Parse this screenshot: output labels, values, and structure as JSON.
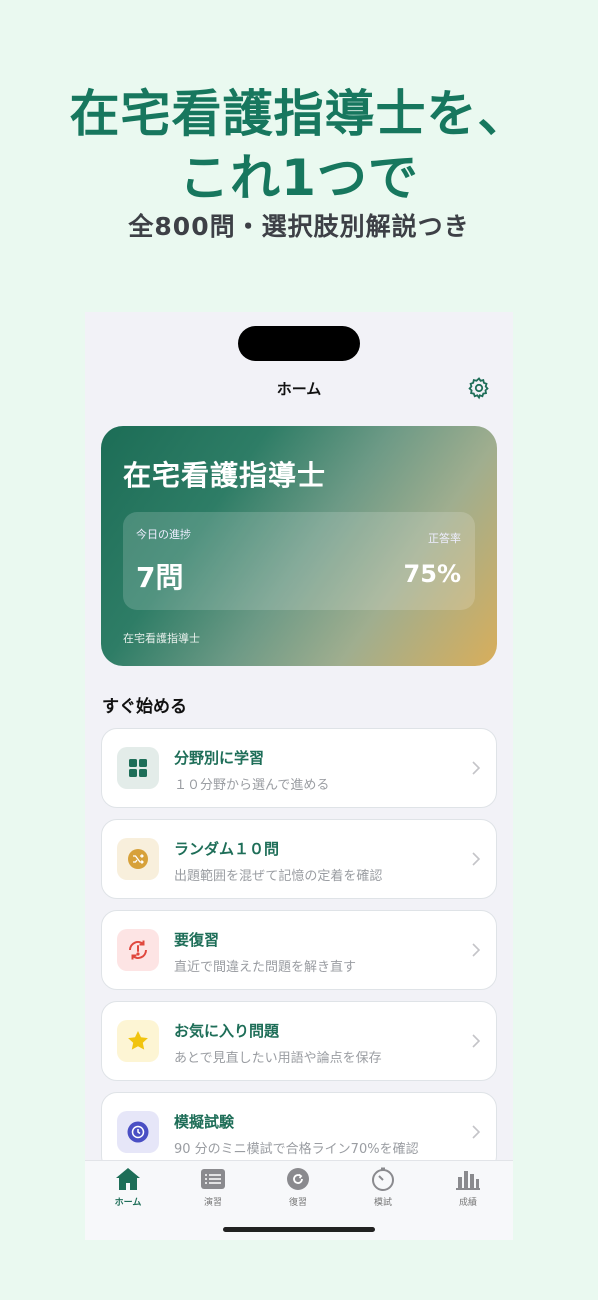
{
  "promo": {
    "title_line1": "在宅看護指導士を、",
    "title_line2": "これ1つで",
    "subtitle": "全800問・選択肢別解説つき"
  },
  "nav": {
    "title": "ホーム"
  },
  "hero_card": {
    "title": "在宅看護指導士",
    "progress_label": "今日の進捗",
    "progress_value": "7問",
    "accuracy_label": "正答率",
    "accuracy_value": "75%",
    "footer": "在宅看護指導士"
  },
  "section": {
    "title": "すぐ始める"
  },
  "menu": [
    {
      "title": "分野別に学習",
      "subtitle": "１０分野から選んで進める",
      "icon": "grid-icon",
      "icon_bg": "#e3ece9",
      "icon_color": "#1e6e58"
    },
    {
      "title": "ランダム１０問",
      "subtitle": "出題範囲を混ぜて記憶の定着を確認",
      "icon": "shuffle-icon",
      "icon_bg": "#f8efdc",
      "icon_color": "#d7a13a"
    },
    {
      "title": "要復習",
      "subtitle": "直近で間違えた問題を解き直す",
      "icon": "retry-icon",
      "icon_bg": "#fde4e4",
      "icon_color": "#e0473d"
    },
    {
      "title": "お気に入り問題",
      "subtitle": "あとで見直したい用語や論点を保存",
      "icon": "star-icon",
      "icon_bg": "#fdf5d4",
      "icon_color": "#f1c40f"
    },
    {
      "title": "模擬試験",
      "subtitle": "90 分のミニ模試で合格ライン70%を確認",
      "icon": "timer-icon",
      "icon_bg": "#e6e6f8",
      "icon_color": "#4a4fc4"
    }
  ],
  "tabs": [
    {
      "label": "ホーム",
      "icon": "home-icon",
      "active": true
    },
    {
      "label": "演習",
      "icon": "list-icon",
      "active": false
    },
    {
      "label": "復習",
      "icon": "review-icon",
      "active": false
    },
    {
      "label": "模試",
      "icon": "timer-icon",
      "active": false
    },
    {
      "label": "成績",
      "icon": "chart-icon",
      "active": false
    }
  ],
  "colors": {
    "brand": "#1e6e58",
    "promo_bg": "#eaf9f0",
    "inactive_tab": "#8a8a8e"
  }
}
